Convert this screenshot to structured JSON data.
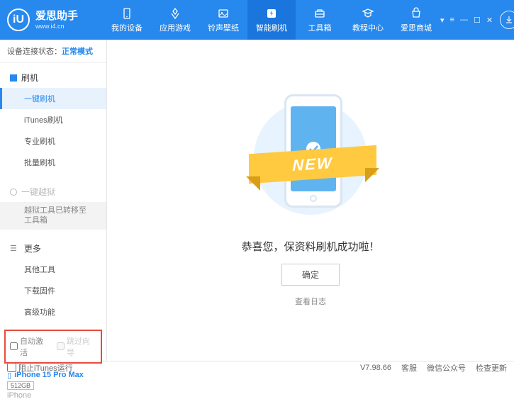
{
  "app": {
    "title": "爱思助手",
    "url": "www.i4.cn",
    "logo_letter": "iU"
  },
  "win_controls": {
    "cart": "▾",
    "menu": "≡",
    "min": "—",
    "max": "☐",
    "close": "✕"
  },
  "nav": [
    {
      "label": "我的设备",
      "icon": "device"
    },
    {
      "label": "应用游戏",
      "icon": "apps"
    },
    {
      "label": "铃声壁纸",
      "icon": "media"
    },
    {
      "label": "智能刷机",
      "icon": "flash",
      "active": true
    },
    {
      "label": "工具箱",
      "icon": "toolbox"
    },
    {
      "label": "教程中心",
      "icon": "tutorial"
    },
    {
      "label": "爱思商城",
      "icon": "shop"
    }
  ],
  "status": {
    "label": "设备连接状态：",
    "value": "正常模式"
  },
  "sidebar": {
    "flash": {
      "header": "刷机",
      "items": [
        "一键刷机",
        "iTunes刷机",
        "专业刷机",
        "批量刷机"
      ]
    },
    "jailbreak": {
      "header": "一键越狱",
      "note": "越狱工具已转移至\n工具箱"
    },
    "more": {
      "header": "更多",
      "items": [
        "其他工具",
        "下载固件",
        "高级功能"
      ]
    },
    "checkboxes": {
      "auto_activate": "自动激活",
      "skip_guide": "跳过向导"
    }
  },
  "device": {
    "name": "iPhone 15 Pro Max",
    "storage": "512GB",
    "type": "iPhone"
  },
  "main": {
    "ribbon": "NEW",
    "success": "恭喜您，保资料刷机成功啦！",
    "ok": "确定",
    "log_link": "查看日志"
  },
  "footer": {
    "block_itunes": "阻止iTunes运行",
    "version": "V7.98.66",
    "links": [
      "客服",
      "微信公众号",
      "检查更新"
    ]
  }
}
